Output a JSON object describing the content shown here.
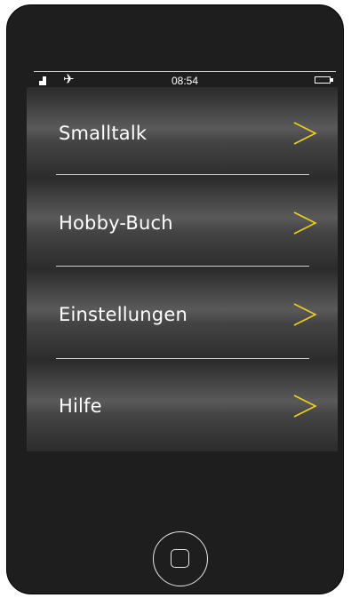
{
  "status_bar": {
    "time": "08:54",
    "icons": [
      "signal-icon",
      "airplane-icon",
      "battery-icon"
    ]
  },
  "menu": {
    "items": [
      {
        "label": "Smalltalk",
        "icon": "chevron-right-icon"
      },
      {
        "label": "Hobby-Buch",
        "icon": "chevron-right-icon"
      },
      {
        "label": "Einstellungen",
        "icon": "chevron-right-icon"
      },
      {
        "label": "Hilfe",
        "icon": "chevron-right-icon"
      }
    ]
  },
  "home_button": {
    "icon": "home-square-icon"
  },
  "colors": {
    "chevron": "#f0d020",
    "phone_body": "#1e1e1e",
    "text": "#ffffff"
  }
}
